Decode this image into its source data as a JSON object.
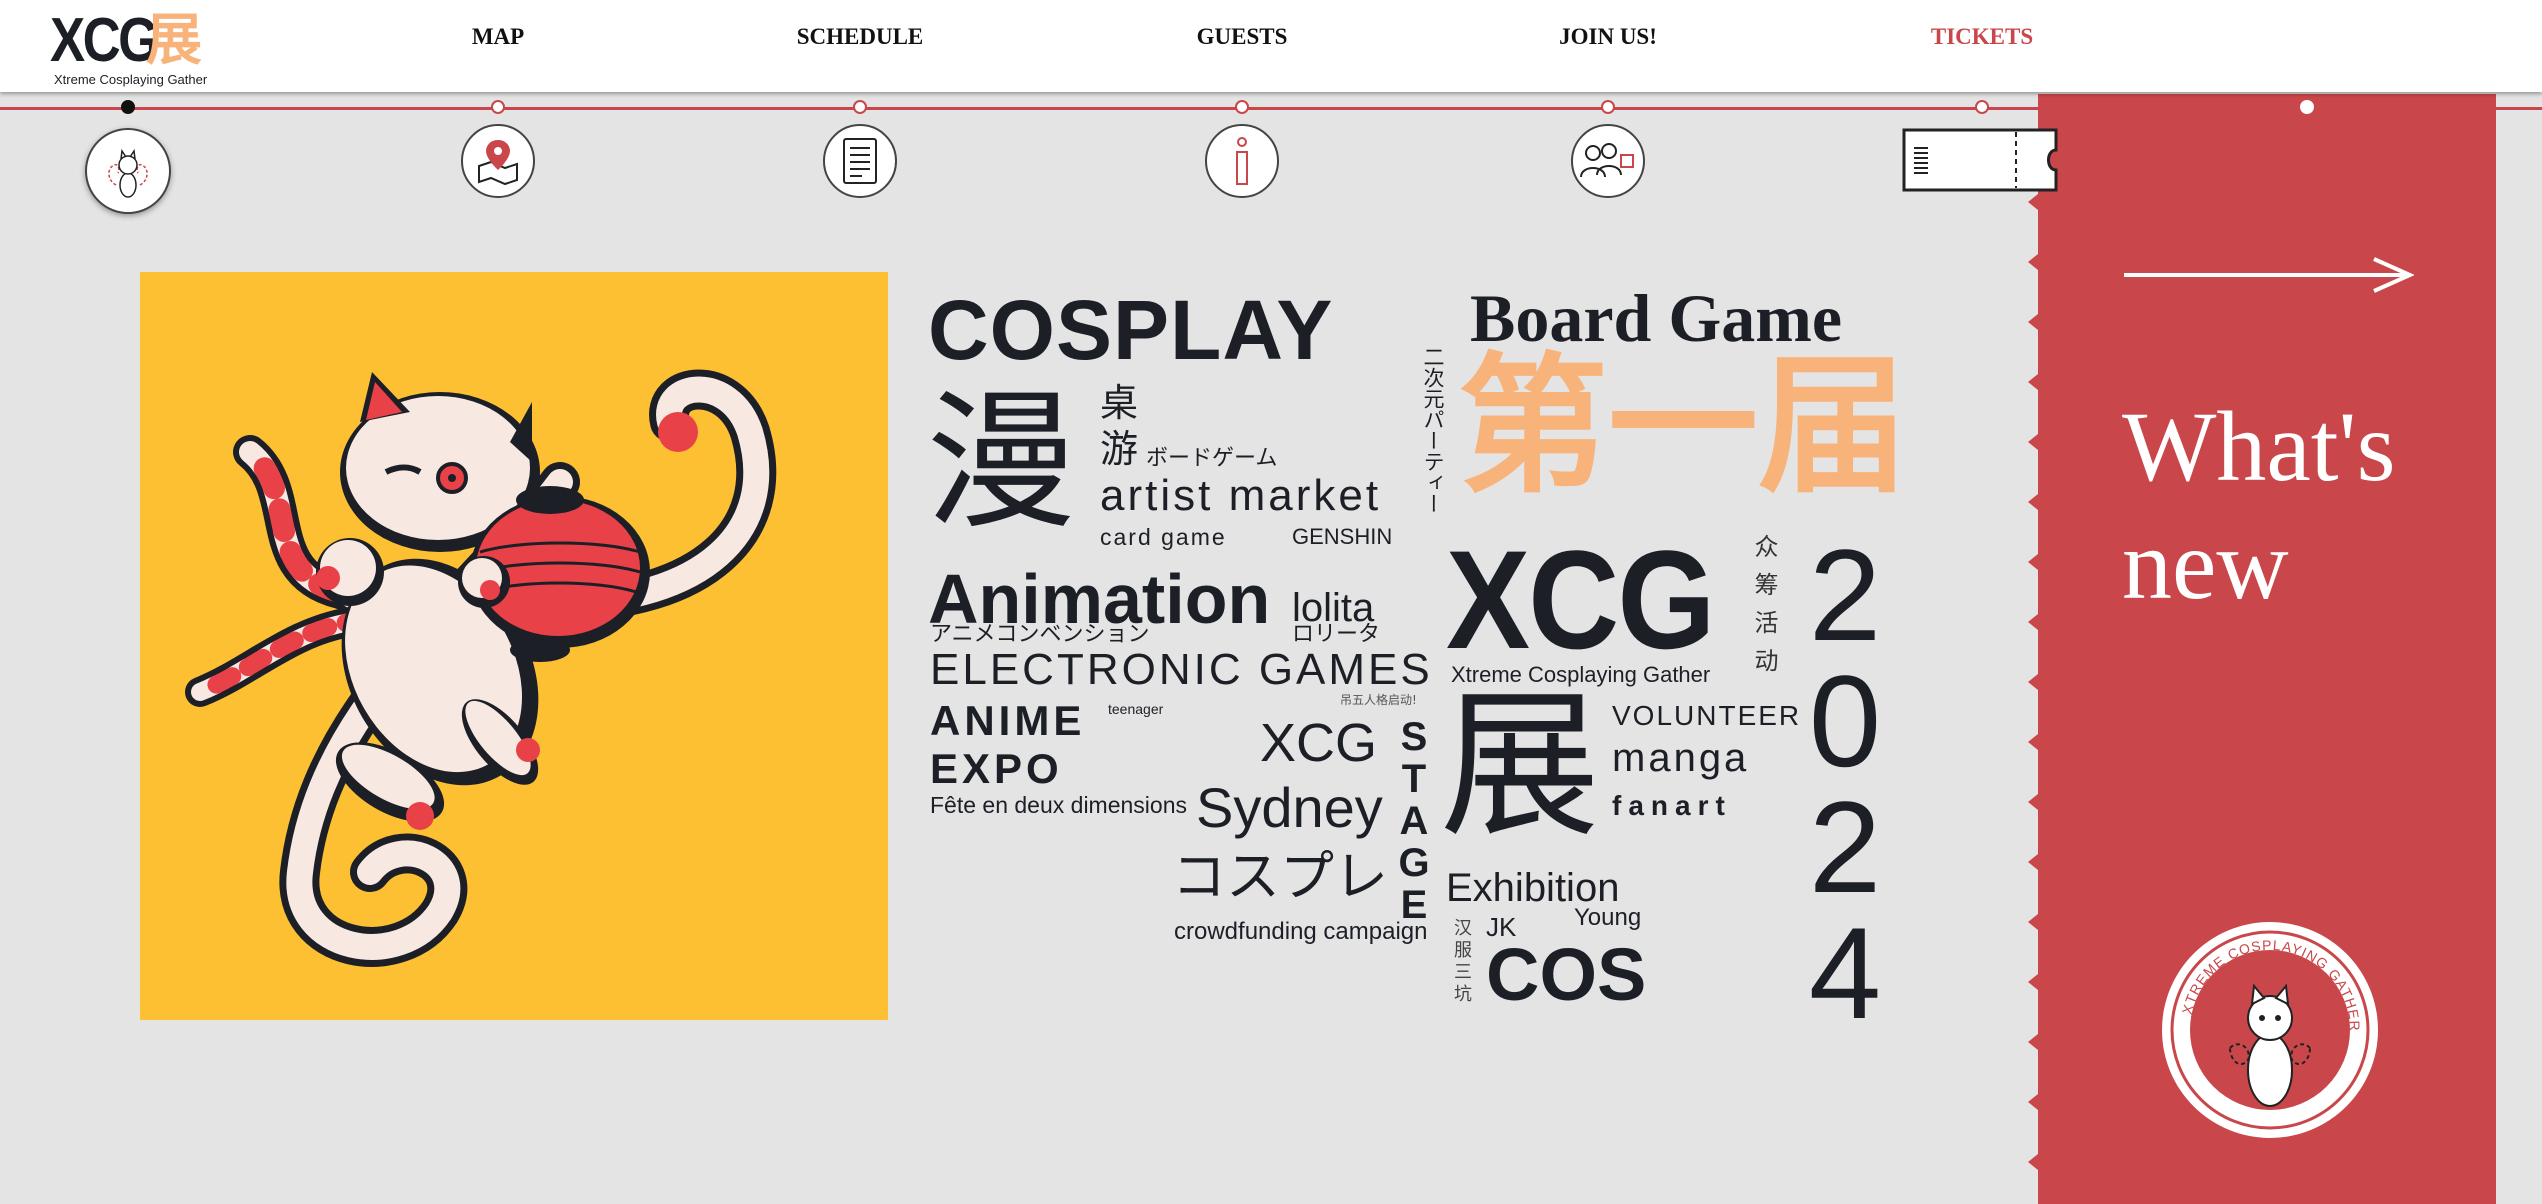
{
  "header": {
    "logo_main": "XCG",
    "logo_kanji": "展",
    "logo_sub": "Xtreme Cosplaying Gather",
    "nav": {
      "map": "MAP",
      "schedule": "SCHEDULE",
      "guests": "GUESTS",
      "join": "JOIN US!",
      "tickets": "TICKETS"
    }
  },
  "timeline": {
    "icons": [
      "cat-mascot-icon",
      "map-pin-icon",
      "document-list-icon",
      "info-icon",
      "people-icon",
      "ticket-icon"
    ]
  },
  "side_panel": {
    "heading": "What's new",
    "badge_text": "XTREME COSPLAYING GATHER"
  },
  "word_cloud": {
    "cosplay": "COSPLAY",
    "board_game": "Board Game",
    "man": "漫",
    "zhuo": "桌",
    "you": "游",
    "boardgame_jp": "ボードゲーム",
    "artist_market": "artist market",
    "card_game": "card game",
    "genshin": "GENSHIN",
    "nijigen": "二次元パーティー",
    "first": "第一届",
    "xcg_big": "XCG",
    "xcg_sub": "Xtreme Cosplaying Gather",
    "crowd": "众筹活动",
    "year": [
      "2",
      "0",
      "2",
      "4"
    ],
    "animation": "Animation",
    "lolita": "lolita",
    "anime_convention_jp": "アニメコンベンション",
    "lolita_jp": "ロリータ",
    "electronic_games": "ELECTRONIC GAMES",
    "tiny_cn": "吊五人格启动!",
    "anime": "ANIME",
    "teenager": "teenager",
    "expo": "EXPO",
    "xcg_small": "XCG",
    "stage": [
      "S",
      "T",
      "A",
      "G",
      "E"
    ],
    "zhan": "展",
    "volunteer": "VOLUNTEER",
    "manga": "manga",
    "fanart": "fanart",
    "fete": "Fête en deux dimensions",
    "sydney": "Sydney",
    "cosplay_jp": "コスプレ",
    "crowdfunding": "crowdfunding campaign",
    "exhibition": "Exhibition",
    "hanfu": "汉服三坑",
    "jk": "JK",
    "young": "Young",
    "cos": "COS"
  },
  "colors": {
    "accent_red": "#c9474a",
    "peach": "#f8b37b",
    "poster_yellow": "#fcc032",
    "ink": "#1d1f27",
    "background": "#e4e4e4"
  }
}
